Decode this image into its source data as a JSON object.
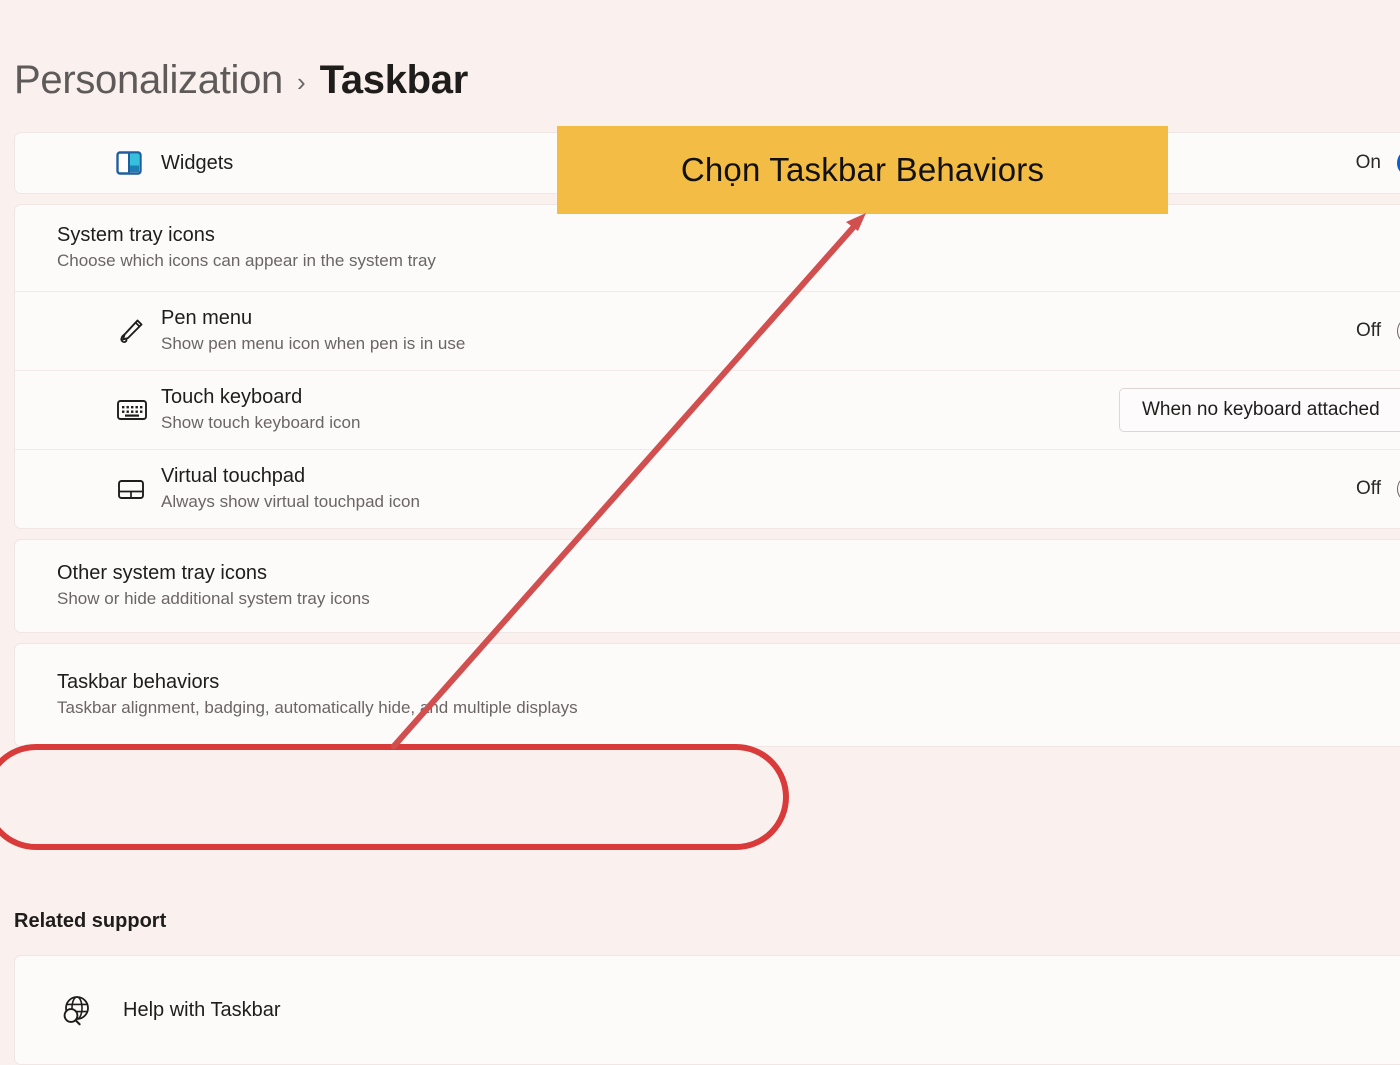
{
  "breadcrumb": {
    "parent": "Personalization",
    "separator": "›",
    "current": "Taskbar"
  },
  "annotation": {
    "callout_text": "Chọn Taskbar Behaviors",
    "callout_bg": "#f2bc45",
    "marker_color": "#d93b3b",
    "arrow_from": "Taskbar behaviors row",
    "arrow_to": "callout box"
  },
  "settings": {
    "widgets": {
      "icon": "widgets-icon",
      "title": "Widgets",
      "state": "On",
      "toggle": "on"
    },
    "system_tray": {
      "heading": "System tray icons",
      "description": "Choose which icons can appear in the system tray",
      "items": [
        {
          "icon": "pen-icon",
          "title": "Pen menu",
          "description": "Show pen menu icon when pen is in use",
          "state": "Off",
          "control": "toggle",
          "toggle": "off"
        },
        {
          "icon": "touch-keyboard-icon",
          "title": "Touch keyboard",
          "description": "Show touch keyboard icon",
          "control": "dropdown",
          "value": "When no keyboard attached"
        },
        {
          "icon": "virtual-touchpad-icon",
          "title": "Virtual touchpad",
          "description": "Always show virtual touchpad icon",
          "state": "Off",
          "control": "toggle",
          "toggle": "off"
        }
      ]
    },
    "other_tray": {
      "title": "Other system tray icons",
      "description": "Show or hide additional system tray icons"
    },
    "taskbar_behaviors": {
      "title": "Taskbar behaviors",
      "description": "Taskbar alignment, badging, automatically hide, and multiple displays",
      "highlighted": true
    }
  },
  "related_support": {
    "heading": "Related support",
    "items": [
      {
        "icon": "help-globe-icon",
        "label": "Help with Taskbar"
      }
    ]
  },
  "colors": {
    "page_background": "#faf1ef",
    "card_background": "#fdfafa",
    "accent_toggle_on": "#0a62c8",
    "annotation_yellow": "#f2bc45",
    "annotation_red": "#d93b3b"
  }
}
